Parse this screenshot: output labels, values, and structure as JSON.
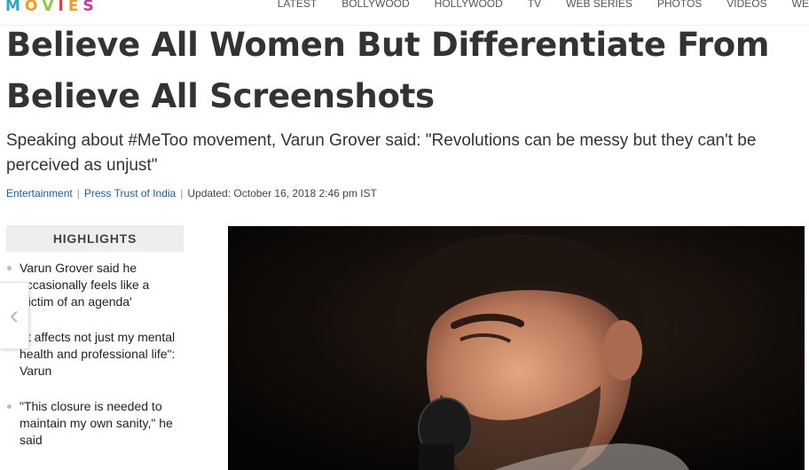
{
  "site": {
    "logo_letters": [
      "M",
      "O",
      "V",
      "I",
      "E",
      "S"
    ],
    "logo_colors": [
      "#2aa6c9",
      "#f29b1d",
      "#8dc63f",
      "#e8364e",
      "#f29b1d",
      "#c23b9c"
    ]
  },
  "nav": {
    "items": [
      "LATEST",
      "BOLLYWOOD",
      "HOLLYWOOD",
      "TV",
      "WEB SERIES",
      "PHOTOS",
      "VIDEOS",
      "WEB"
    ]
  },
  "article": {
    "headline": "Believe All Women But Differentiate From Believe All Screenshots",
    "subtitle": "Speaking about #MeToo movement, Varun Grover said: \"Revolutions can be messy but they can't be perceived as unjust\"",
    "category": "Entertainment",
    "author": "Press Trust of India",
    "updated": "Updated: October 16, 2018 2:46 pm IST"
  },
  "highlights": {
    "title": "HIGHLIGHTS",
    "items": [
      "Varun Grover said he occasionally feels like a 'victim of an agenda'",
      "\"It affects not just my mental health and professional life\": Varun",
      "\"This closure is needed to maintain my own sanity,\" he said"
    ]
  },
  "prev_arrow": "‹"
}
